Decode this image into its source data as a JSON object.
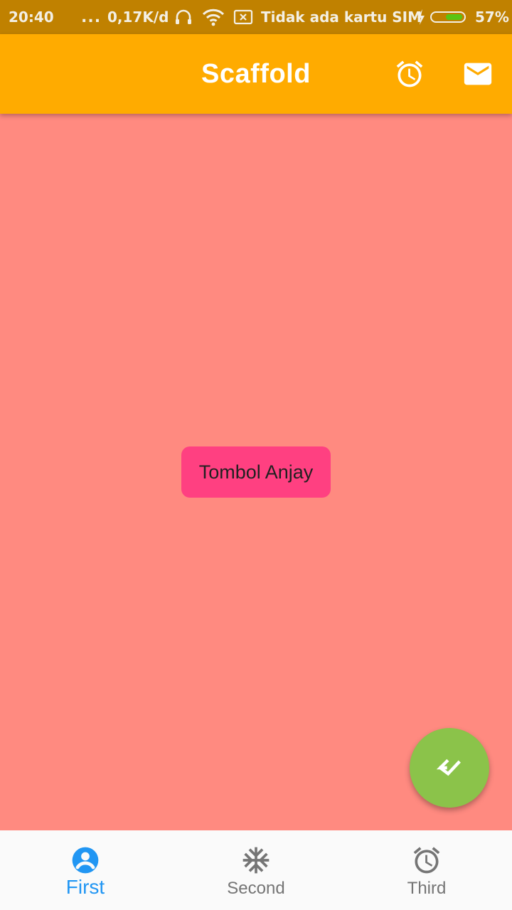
{
  "status_bar": {
    "time": "20:40",
    "dots": "...",
    "net_speed": "0,17K/d",
    "carrier": "Tidak ada kartu SIM",
    "battery_percent_label": "57%",
    "battery_level": 0.57,
    "icons": [
      "headset-icon",
      "wifi-icon",
      "no-sim-icon",
      "charging-bolt-icon",
      "battery-icon"
    ]
  },
  "app_bar": {
    "title": "Scaffold",
    "actions": [
      {
        "icon": "alarm-icon"
      },
      {
        "icon": "mail-icon"
      }
    ],
    "color": "#ffab00"
  },
  "body": {
    "background": "#ff8a80",
    "button_label": "Tombol Anjay",
    "button_color": "#ff4081"
  },
  "fab": {
    "icon": "call-received-check-icon",
    "color": "#8bc34a"
  },
  "bottom_nav": {
    "items": [
      {
        "label": "First",
        "icon": "account-circle-icon",
        "active": true
      },
      {
        "label": "Second",
        "icon": "snowflake-icon",
        "active": false
      },
      {
        "label": "Third",
        "icon": "alarm-icon",
        "active": false
      }
    ],
    "active_color": "#2196f3",
    "inactive_color": "#757575"
  }
}
